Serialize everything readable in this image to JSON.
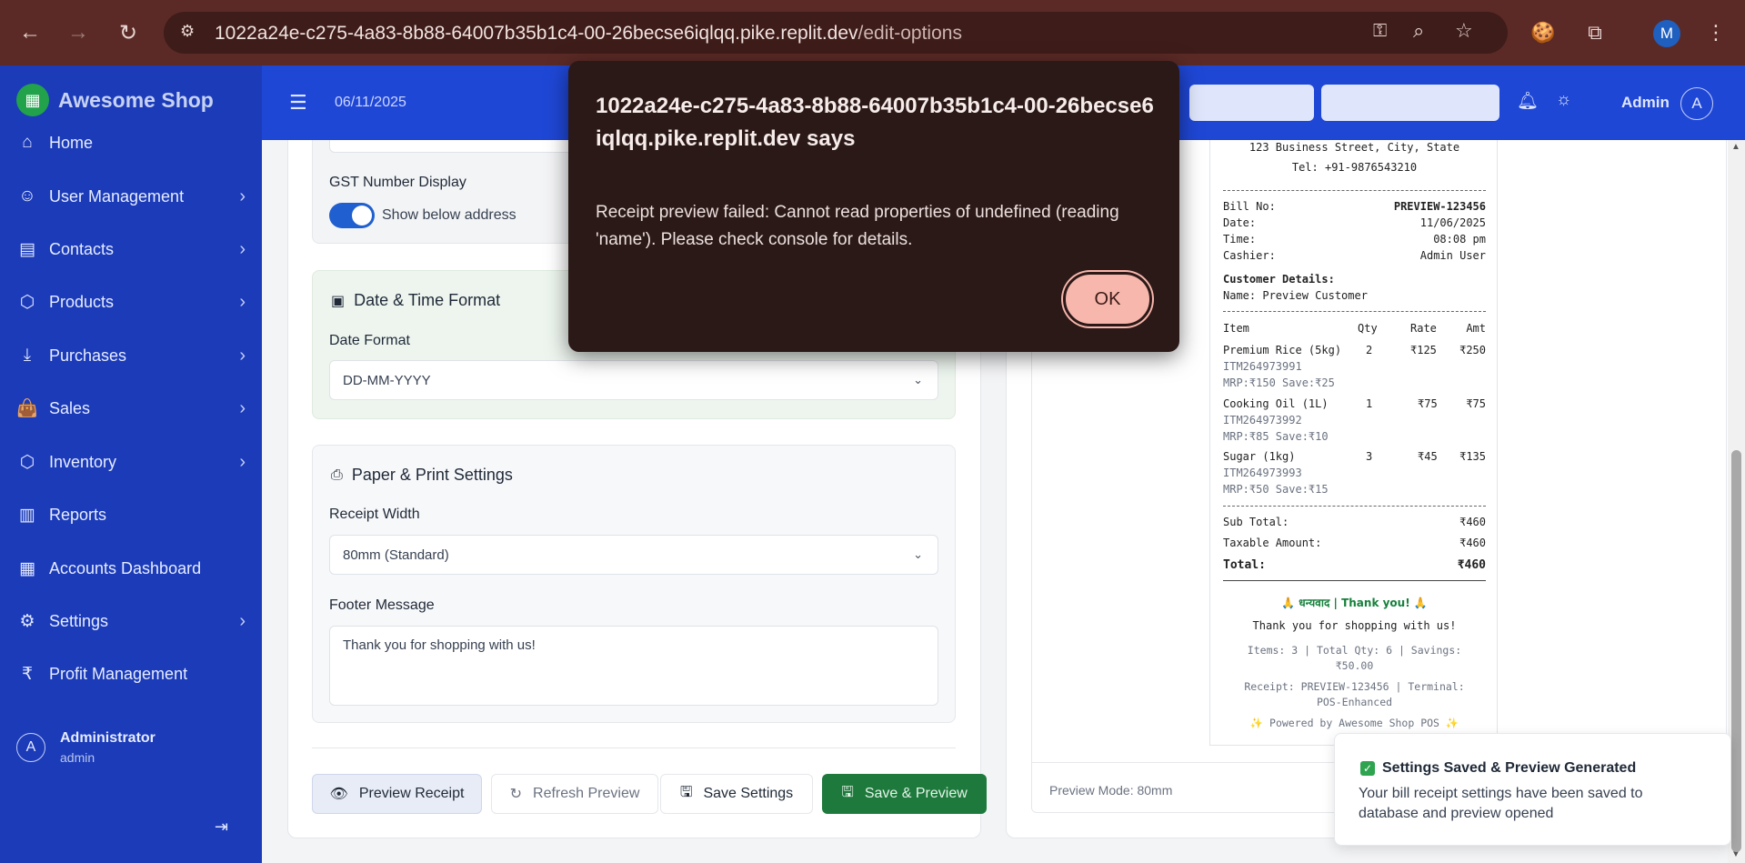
{
  "browser": {
    "url_host": "1022a24e-c275-4a83-8b88-64007b35b1c4-00-26becse6iqlqq.pike.replit.dev",
    "url_path": "/edit-options",
    "profile_initial": "M"
  },
  "sidebar": {
    "brand": "Awesome Shop",
    "items": [
      {
        "label": "Home",
        "icon": "home-icon"
      },
      {
        "label": "User Management",
        "icon": "user-icon"
      },
      {
        "label": "Contacts",
        "icon": "contacts-icon"
      },
      {
        "label": "Products",
        "icon": "box-icon"
      },
      {
        "label": "Purchases",
        "icon": "download-icon"
      },
      {
        "label": "Sales",
        "icon": "shopping-bag-icon"
      },
      {
        "label": "Inventory",
        "icon": "box-icon"
      },
      {
        "label": "Reports",
        "icon": "bar-chart-icon"
      },
      {
        "label": "Accounts Dashboard",
        "icon": "calculator-icon"
      },
      {
        "label": "Settings",
        "icon": "gear-icon"
      },
      {
        "label": "Profit Management",
        "icon": "rupee-icon"
      }
    ],
    "user": {
      "initial": "A",
      "name": "Administrator",
      "role": "admin"
    }
  },
  "header": {
    "date": "06/11/2025",
    "admin_label": "Admin",
    "admin_initial": "A"
  },
  "form": {
    "gst_label": "GST Number Display",
    "gst_toggle_text": "Show below address",
    "date_section_title": "Date & Time Format",
    "date_format_label": "Date Format",
    "date_format_value": "DD-MM-YYYY",
    "paper_section_title": "Paper & Print Settings",
    "receipt_width_label": "Receipt Width",
    "receipt_width_value": "80mm (Standard)",
    "footer_label": "Footer Message",
    "footer_value": "Thank you for shopping with us!"
  },
  "buttons": {
    "preview": "Preview Receipt",
    "refresh": "Refresh Preview",
    "save": "Save Settings",
    "save_preview": "Save & Preview"
  },
  "receipt": {
    "address": "123 Business Street, City, State",
    "tel": "Tel: +91-9876543210",
    "bill_no_label": "Bill No:",
    "bill_no": "PREVIEW-123456",
    "date_label": "Date:",
    "date": "11/06/2025",
    "time_label": "Time:",
    "time": "08:08 pm",
    "cashier_label": "Cashier:",
    "cashier": "Admin User",
    "customer_heading": "Customer Details:",
    "customer_name": "Name: Preview Customer",
    "columns": {
      "item": "Item",
      "qty": "Qty",
      "rate": "Rate",
      "amt": "Amt"
    },
    "items": [
      {
        "name": "Premium Rice (5kg)",
        "qty": "2",
        "rate": "₹125",
        "amt": "₹250",
        "code": "ITM264973991",
        "mrp": "MRP:₹150 Save:₹25"
      },
      {
        "name": "Cooking Oil (1L)",
        "qty": "1",
        "rate": "₹75",
        "amt": "₹75",
        "code": "ITM264973992",
        "mrp": "MRP:₹85 Save:₹10"
      },
      {
        "name": "Sugar (1kg)",
        "qty": "3",
        "rate": "₹45",
        "amt": "₹135",
        "code": "ITM264973993",
        "mrp": "MRP:₹50 Save:₹15"
      }
    ],
    "subtotal_label": "Sub Total:",
    "subtotal": "₹460",
    "taxable_label": "Taxable Amount:",
    "taxable": "₹460",
    "total_label": "Total:",
    "total": "₹460",
    "thanks_banner": "🙏 धन्यवाद | Thank you! 🙏",
    "thanks_msg": "Thank you for shopping with us!",
    "summary_line1": "Items: 3 | Total Qty: 6 | Savings:",
    "summary_line2": "₹50.00",
    "receipt_line1": "Receipt: PREVIEW-123456 | Terminal:",
    "receipt_line2": "POS-Enhanced",
    "powered": "✨ Powered by Awesome Shop POS ✨"
  },
  "preview_mode": "Preview Mode: 80mm",
  "toast": {
    "title": "Settings Saved & Preview Generated",
    "body": "Your bill receipt settings have been saved to database and preview opened"
  },
  "dialog": {
    "title": "1022a24e-c275-4a83-8b88-64007b35b1c4-00-26becse6iqlqq.pike.replit.dev says",
    "message": "Receipt preview failed: Cannot read properties of undefined (reading 'name'). Please check console for details.",
    "ok": "OK"
  },
  "colors": {
    "sidebar": "#1b3bb8",
    "header": "#1f47d6",
    "save_preview_button": "#1e7a3c",
    "dialog_bg": "#2b1917",
    "dialog_ok": "#f8b7ad"
  }
}
